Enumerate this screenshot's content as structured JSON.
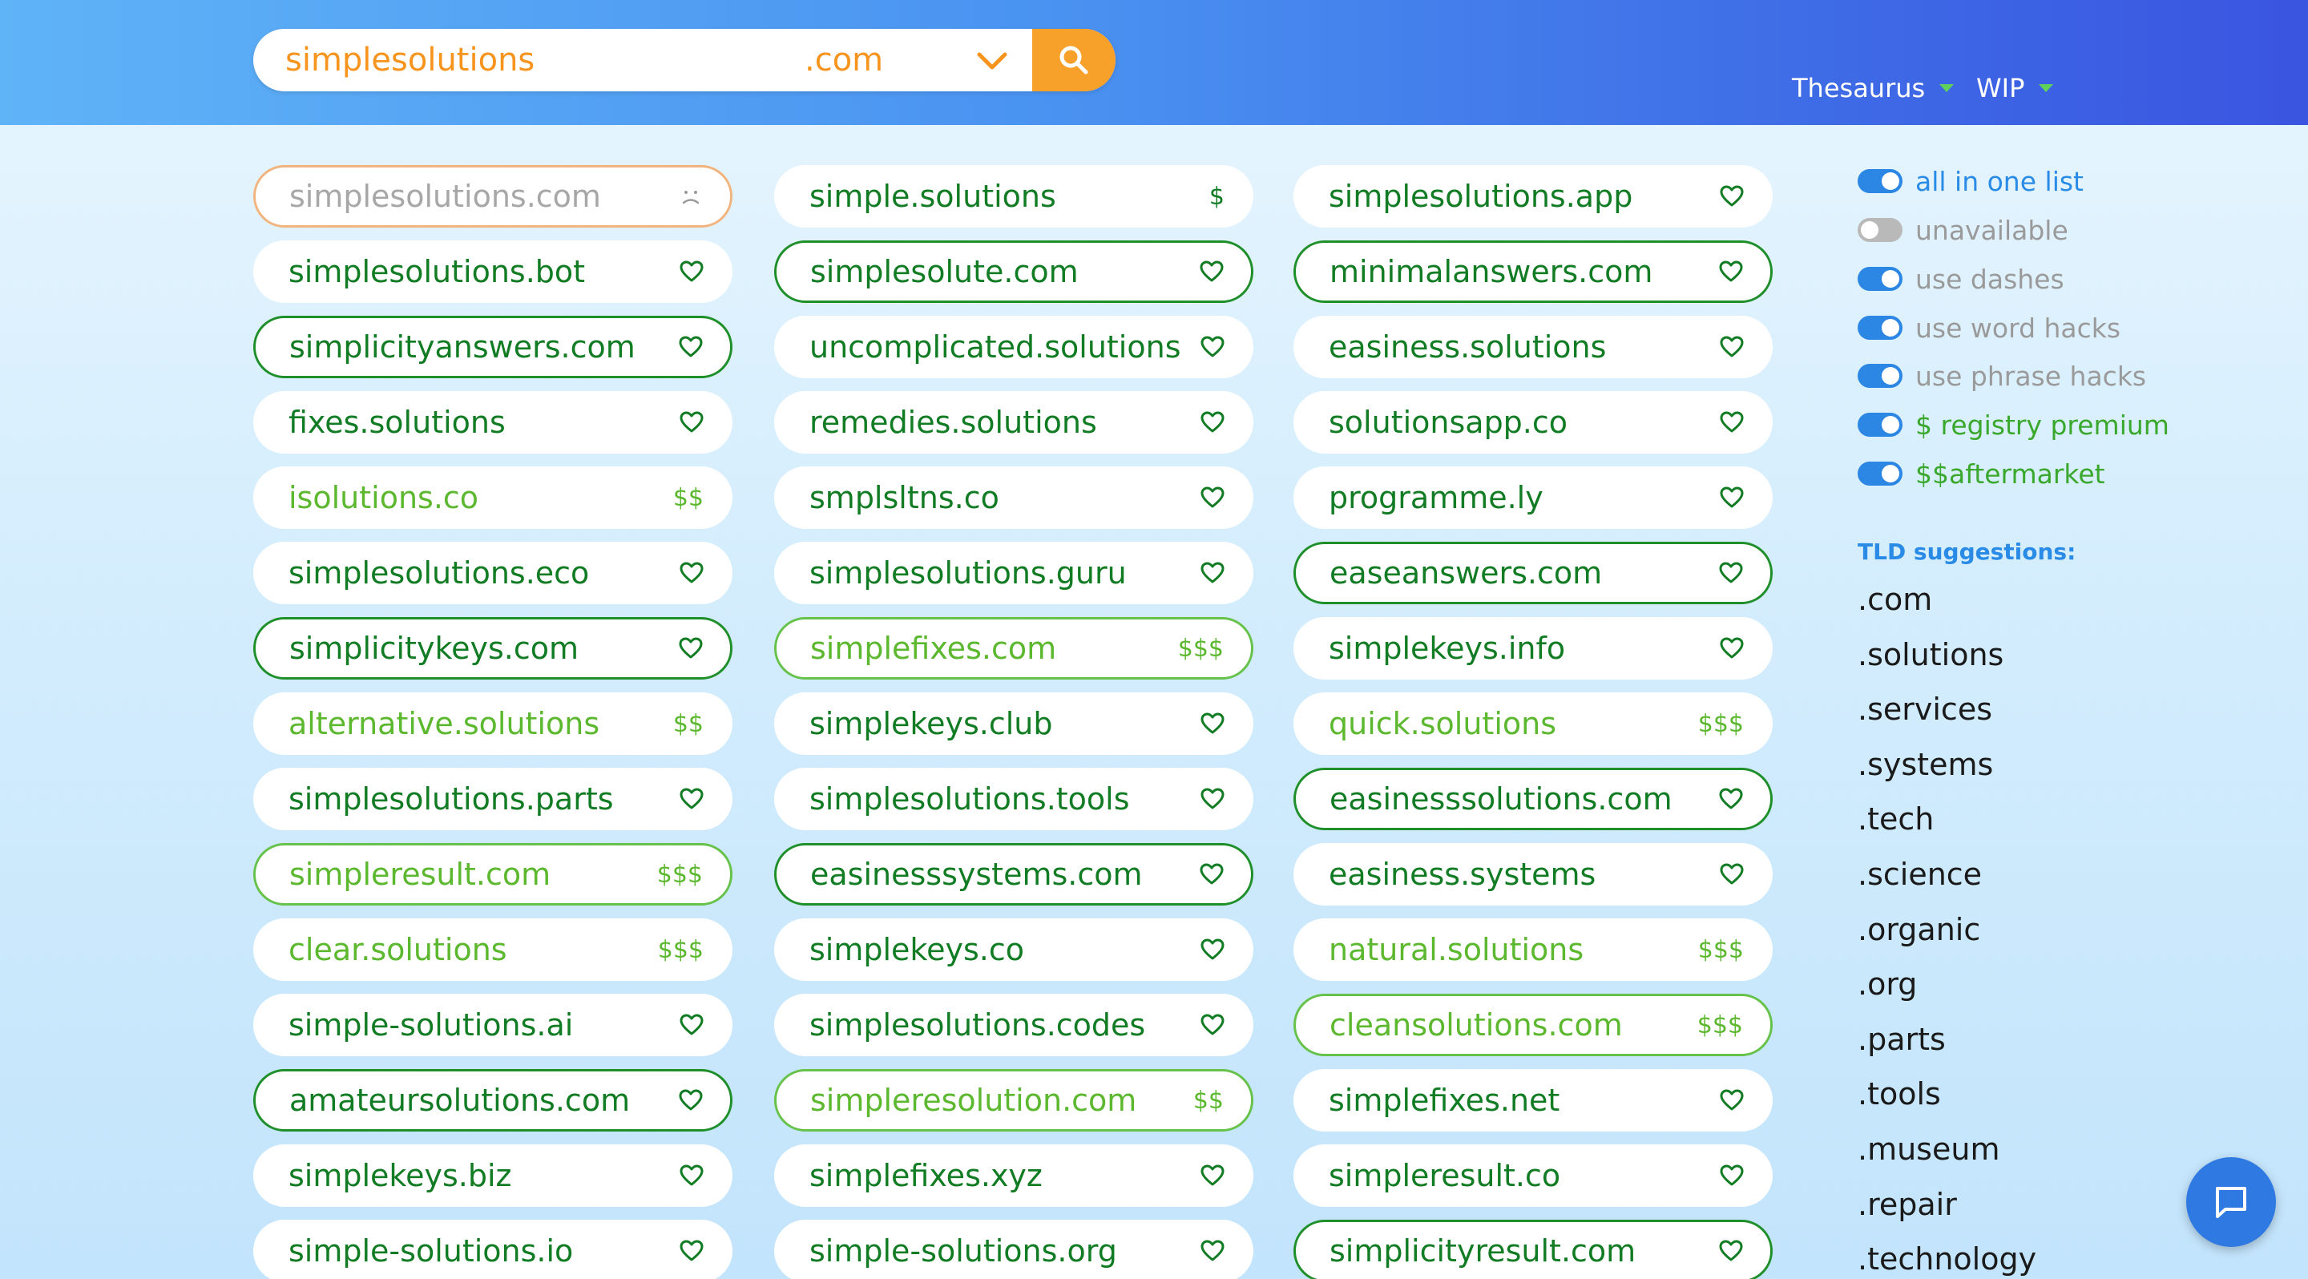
{
  "search": {
    "query": "simplesolutions",
    "tld": ".com"
  },
  "nav": {
    "thesaurus_label": "Thesaurus",
    "wip_label": "WIP"
  },
  "colors": {
    "dark_green": "#117c23",
    "light_green": "#5cb82e",
    "accent_orange": "#f7941d",
    "accent_blue": "#2a8be6"
  },
  "results": [
    {
      "name": "simplesolutions.com",
      "tag": "sad-face-icon",
      "price": "",
      "style": "taken"
    },
    {
      "name": "simple.solutions",
      "tag": "price",
      "price": "$",
      "style": "plain"
    },
    {
      "name": "simplesolutions.app",
      "tag": "heart-icon",
      "price": "",
      "style": "plain"
    },
    {
      "name": "simplesolutions.bot",
      "tag": "heart-icon",
      "price": "",
      "style": "plain"
    },
    {
      "name": "simplesolute.com",
      "tag": "heart-icon",
      "price": "",
      "style": "outlined"
    },
    {
      "name": "minimalanswers.com",
      "tag": "heart-icon",
      "price": "",
      "style": "outlined"
    },
    {
      "name": "simplicityanswers.com",
      "tag": "heart-icon",
      "price": "",
      "style": "outlined"
    },
    {
      "name": "uncomplicated.solutions",
      "tag": "heart-icon",
      "price": "",
      "style": "plain"
    },
    {
      "name": "easiness.solutions",
      "tag": "heart-icon",
      "price": "",
      "style": "plain"
    },
    {
      "name": "fixes.solutions",
      "tag": "heart-icon",
      "price": "",
      "style": "plain"
    },
    {
      "name": "remedies.solutions",
      "tag": "heart-icon",
      "price": "",
      "style": "plain"
    },
    {
      "name": "solutionsapp.co",
      "tag": "heart-icon",
      "price": "",
      "style": "plain"
    },
    {
      "name": "isolutions.co",
      "tag": "price",
      "price": "$$",
      "style": "light"
    },
    {
      "name": "smplsltns.co",
      "tag": "heart-icon",
      "price": "",
      "style": "plain"
    },
    {
      "name": "programme.ly",
      "tag": "heart-icon",
      "price": "",
      "style": "plain"
    },
    {
      "name": "simplesolutions.eco",
      "tag": "heart-icon",
      "price": "",
      "style": "plain"
    },
    {
      "name": "simplesolutions.guru",
      "tag": "heart-icon",
      "price": "",
      "style": "plain"
    },
    {
      "name": "easeanswers.com",
      "tag": "heart-icon",
      "price": "",
      "style": "outlined"
    },
    {
      "name": "simplicitykeys.com",
      "tag": "heart-icon",
      "price": "",
      "style": "outlined"
    },
    {
      "name": "simplefixes.com",
      "tag": "price",
      "price": "$$$",
      "style": "outlined-light light"
    },
    {
      "name": "simplekeys.info",
      "tag": "heart-icon",
      "price": "",
      "style": "plain"
    },
    {
      "name": "alternative.solutions",
      "tag": "price",
      "price": "$$",
      "style": "light"
    },
    {
      "name": "simplekeys.club",
      "tag": "heart-icon",
      "price": "",
      "style": "plain"
    },
    {
      "name": "quick.solutions",
      "tag": "price",
      "price": "$$$",
      "style": "light"
    },
    {
      "name": "simplesolutions.parts",
      "tag": "heart-icon",
      "price": "",
      "style": "plain"
    },
    {
      "name": "simplesolutions.tools",
      "tag": "heart-icon",
      "price": "",
      "style": "plain"
    },
    {
      "name": "easinesssolutions.com",
      "tag": "heart-icon",
      "price": "",
      "style": "outlined"
    },
    {
      "name": "simpleresult.com",
      "tag": "price",
      "price": "$$$",
      "style": "outlined-light light"
    },
    {
      "name": "easinesssystems.com",
      "tag": "heart-icon",
      "price": "",
      "style": "outlined"
    },
    {
      "name": "easiness.systems",
      "tag": "heart-icon",
      "price": "",
      "style": "plain"
    },
    {
      "name": "clear.solutions",
      "tag": "price",
      "price": "$$$",
      "style": "light"
    },
    {
      "name": "simplekeys.co",
      "tag": "heart-icon",
      "price": "",
      "style": "plain"
    },
    {
      "name": "natural.solutions",
      "tag": "price",
      "price": "$$$",
      "style": "light"
    },
    {
      "name": "simple-solutions.ai",
      "tag": "heart-icon",
      "price": "",
      "style": "plain"
    },
    {
      "name": "simplesolutions.codes",
      "tag": "heart-icon",
      "price": "",
      "style": "plain"
    },
    {
      "name": "cleansolutions.com",
      "tag": "price",
      "price": "$$$",
      "style": "outlined-light light"
    },
    {
      "name": "amateursolutions.com",
      "tag": "heart-icon",
      "price": "",
      "style": "outlined"
    },
    {
      "name": "simpleresolution.com",
      "tag": "price",
      "price": "$$",
      "style": "outlined-light light"
    },
    {
      "name": "simplefixes.net",
      "tag": "heart-icon",
      "price": "",
      "style": "plain"
    },
    {
      "name": "simplekeys.biz",
      "tag": "heart-icon",
      "price": "",
      "style": "plain"
    },
    {
      "name": "simplefixes.xyz",
      "tag": "heart-icon",
      "price": "",
      "style": "plain"
    },
    {
      "name": "simpleresult.co",
      "tag": "heart-icon",
      "price": "",
      "style": "plain"
    },
    {
      "name": "simple-solutions.io",
      "tag": "heart-icon",
      "price": "",
      "style": "plain"
    },
    {
      "name": "simple-solutions.org",
      "tag": "heart-icon",
      "price": "",
      "style": "plain"
    },
    {
      "name": "simplicityresult.com",
      "tag": "heart-icon",
      "price": "",
      "style": "outlined"
    }
  ],
  "options": [
    {
      "label": "all in one list",
      "on": true,
      "color": "blue"
    },
    {
      "label": "unavailable",
      "on": false,
      "color": "gray"
    },
    {
      "label": "use dashes",
      "on": true,
      "color": "gray"
    },
    {
      "label": "use word hacks",
      "on": true,
      "color": "gray"
    },
    {
      "label": "use phrase hacks",
      "on": true,
      "color": "gray"
    },
    {
      "label": "$ registry premium",
      "on": true,
      "color": "green"
    },
    {
      "label": "$$aftermarket",
      "on": true,
      "color": "green"
    }
  ],
  "tld_suggestions": {
    "title": "TLD suggestions:",
    "items": [
      ".com",
      ".solutions",
      ".services",
      ".systems",
      ".tech",
      ".science",
      ".organic",
      ".org",
      ".parts",
      ".tools",
      ".museum",
      ".repair",
      ".technology"
    ]
  }
}
